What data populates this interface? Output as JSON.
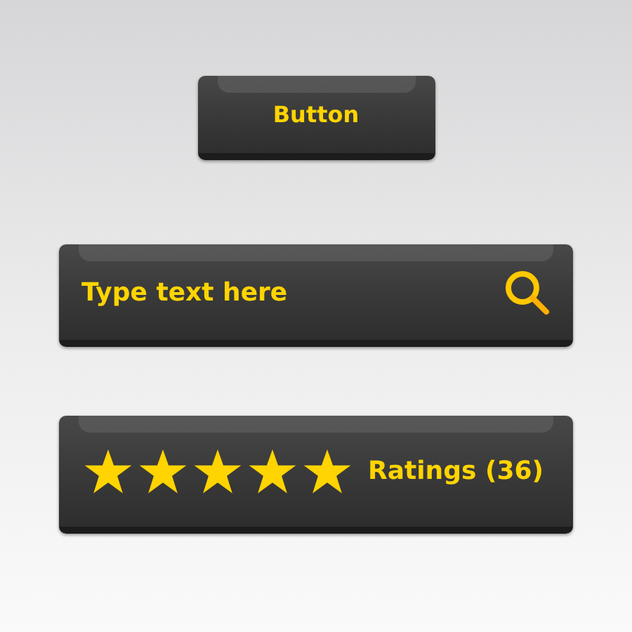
{
  "button": {
    "label": "Button"
  },
  "search": {
    "placeholder": "Type text here"
  },
  "rating": {
    "stars": 5,
    "label": "Ratings (36)"
  }
}
